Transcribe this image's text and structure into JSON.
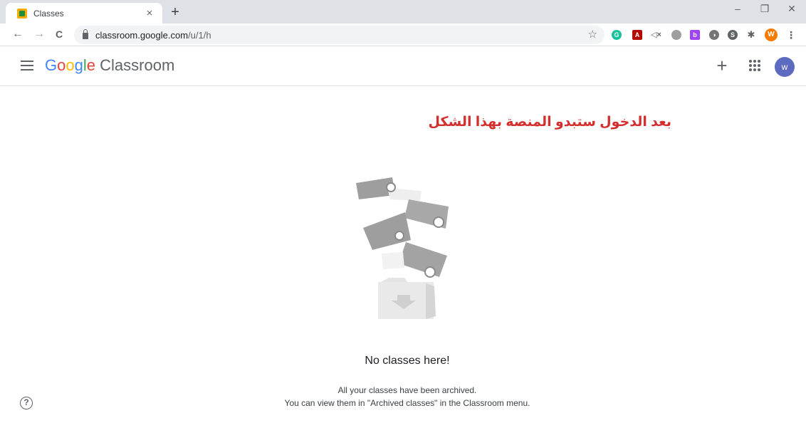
{
  "browser": {
    "tab_title": "Classes",
    "tab_close": "×",
    "new_tab": "+",
    "window_minimize": "–",
    "window_restore": "❐",
    "window_close": "✕",
    "back": "←",
    "forward": "→",
    "reload": "C",
    "url_host": "classroom.google.com",
    "url_path": "/u/1/h",
    "bookmark_star": "☆",
    "profile_initial": "W",
    "extensions": [
      "grammarly-icon",
      "acrobat-icon",
      "mute-icon",
      "extension-icon",
      "b-extension-icon",
      "extension-icon",
      "extension-icon",
      "puzzle-icon"
    ]
  },
  "app": {
    "brand_letters": [
      "G",
      "o",
      "o",
      "g",
      "l",
      "e"
    ],
    "brand_product": "Classroom",
    "create_label": "+",
    "avatar_initial": "w"
  },
  "annotation": "بعد الدخول ستبدو المنصة بهذا الشكل",
  "empty_state": {
    "title": "No classes here!",
    "line1": "All your classes have been archived.",
    "line2": "You can view them in \"Archived classes\" in the Classroom menu."
  },
  "help_label": "?",
  "colors": {
    "accent_blue": "#4285f4",
    "avatar": "#5c6bc0",
    "annotation_red": "#d32f2f",
    "illustration_gray": "#bdbdbd"
  }
}
